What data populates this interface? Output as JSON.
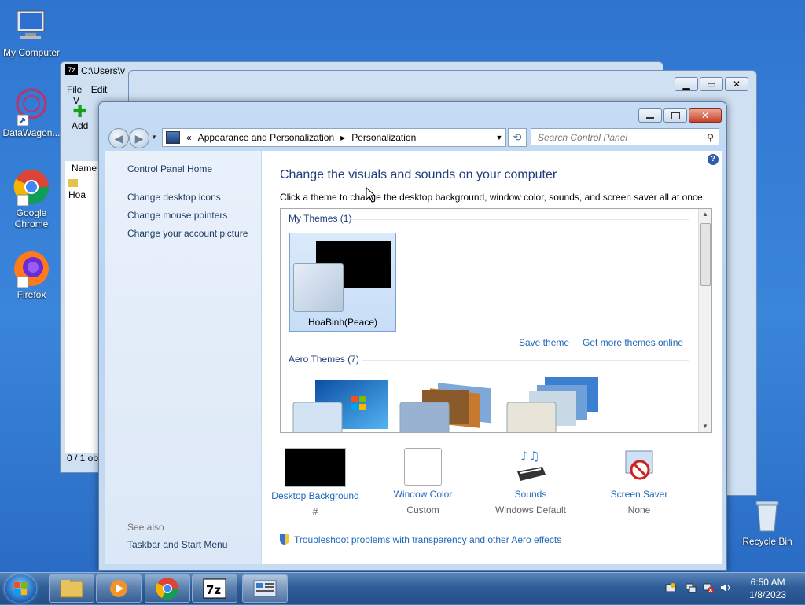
{
  "desktop_icons": [
    {
      "label": "My Computer"
    },
    {
      "label": "DataWagon..."
    },
    {
      "label": "Google Chrome"
    },
    {
      "label": "Firefox"
    },
    {
      "label": "Recycle Bin"
    }
  ],
  "bg_window_7z": {
    "title": "C:\\Users\\v",
    "menu": [
      "File",
      "Edit",
      "V"
    ],
    "add_label": "Add",
    "col_name": "Name",
    "row_item": "Hoa",
    "status": "0 / 1 ob"
  },
  "window": {
    "address": {
      "prefix": "«",
      "crumb1": "Appearance and Personalization",
      "sep": "▸",
      "crumb2": "Personalization"
    },
    "search_placeholder": "Search Control Panel"
  },
  "left_pane": {
    "home": "Control Panel Home",
    "links": [
      "Change desktop icons",
      "Change mouse pointers",
      "Change your account picture"
    ],
    "see_also": "See also",
    "see_also_links": [
      "Taskbar and Start Menu"
    ]
  },
  "main": {
    "title": "Change the visuals and sounds on your computer",
    "subtitle": "Click a theme to change the desktop background, window color, sounds, and screen saver all at once.",
    "my_themes_header": "My Themes (1)",
    "my_theme_name": "HoaBinh(Peace)",
    "save_theme": "Save theme",
    "get_more": "Get more themes online",
    "aero_header": "Aero Themes (7)",
    "bottom": [
      {
        "title": "Desktop Background",
        "value": "#"
      },
      {
        "title": "Window Color",
        "value": "Custom"
      },
      {
        "title": "Sounds",
        "value": "Windows Default"
      },
      {
        "title": "Screen Saver",
        "value": "None"
      }
    ],
    "troubleshoot": "Troubleshoot problems with transparency and other Aero effects"
  },
  "taskbar": {
    "time": "6:50 AM",
    "date": "1/8/2023"
  }
}
